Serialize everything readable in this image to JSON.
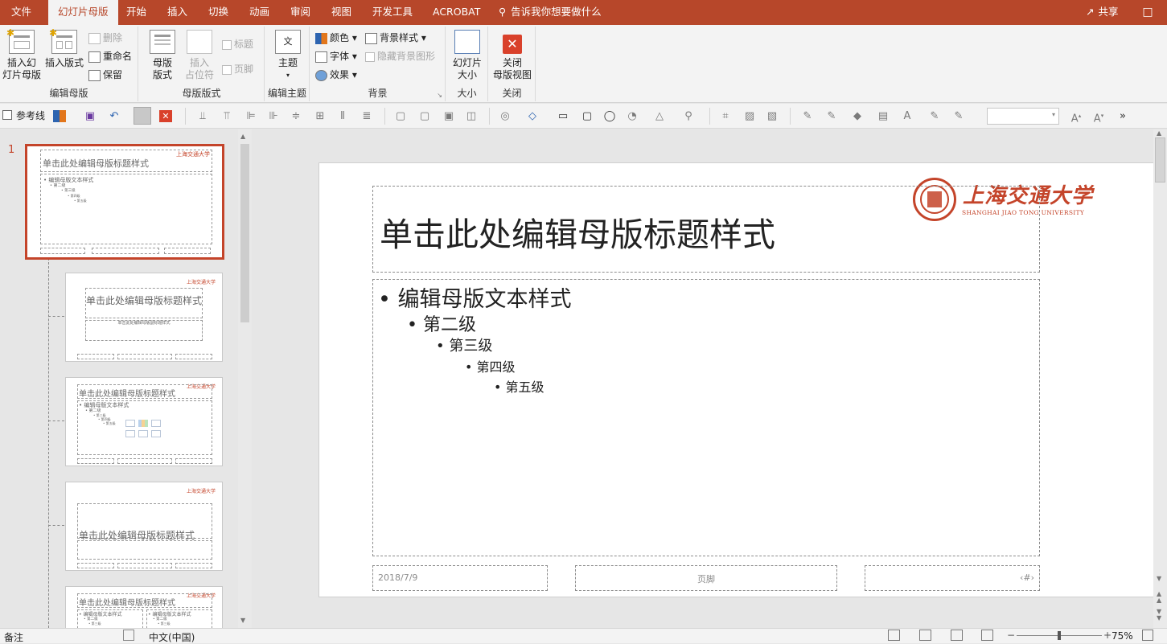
{
  "tabs": {
    "file": "文件",
    "slide_master": "幻灯片母版",
    "home": "开始",
    "insert": "插入",
    "transitions": "切换",
    "animations": "动画",
    "review": "审阅",
    "view": "视图",
    "developer": "开发工具",
    "acrobat": "ACROBAT",
    "tell_me": "告诉我你想要做什么",
    "share": "共享"
  },
  "ribbon": {
    "edit_master": {
      "label": "编辑母版",
      "insert_slide_master": [
        "插入幻",
        "灯片母版"
      ],
      "insert_layout": "插入版式",
      "delete": "删除",
      "rename": "重命名",
      "preserve": "保留"
    },
    "master_layout": {
      "label": "母版版式",
      "master_layout_btn": [
        "母版",
        "版式"
      ],
      "insert_placeholder": [
        "插入",
        "占位符"
      ],
      "title_check": "标题",
      "footer_check": "页脚"
    },
    "edit_theme": {
      "label": "编辑主题",
      "themes": "主题"
    },
    "background": {
      "label": "背景",
      "colors": "颜色",
      "fonts": "字体",
      "effects": "效果",
      "bg_styles": "背景样式",
      "hide_bg_graphics": "隐藏背景图形"
    },
    "size": {
      "label": "大小",
      "slide_size": [
        "幻灯片",
        "大小"
      ]
    },
    "close": {
      "label": "关闭",
      "close_master": [
        "关闭",
        "母版视图"
      ]
    }
  },
  "quick_toolbar": {
    "guides": "参考线"
  },
  "thumbnails": {
    "selected_number": "1",
    "title_text": "单击此处编辑母版标题样式",
    "body_level1": "编辑母版文本样式",
    "body_level2": "第二级",
    "body_level3": "第三级",
    "body_level4": "第四级",
    "body_level5": "第五级",
    "subtitle_text": "单击此处编辑母版副标题样式"
  },
  "slide": {
    "title": "单击此处编辑母版标题样式",
    "levels": [
      "编辑母版文本样式",
      "第二级",
      "第三级",
      "第四级",
      "第五级"
    ],
    "date": "2018/7/9",
    "footer": "页脚",
    "slide_number": "‹#›",
    "logo_cn": "上海交通大学",
    "logo_en": "SHANGHAI JIAO TONG UNIVERSITY"
  },
  "status": {
    "notes": "备注",
    "language": "中文(中国)",
    "zoom": "75%",
    "zoom_level": 0.5
  },
  "colors": {
    "accent": "#b7472a",
    "selected_border": "#c4442a"
  }
}
